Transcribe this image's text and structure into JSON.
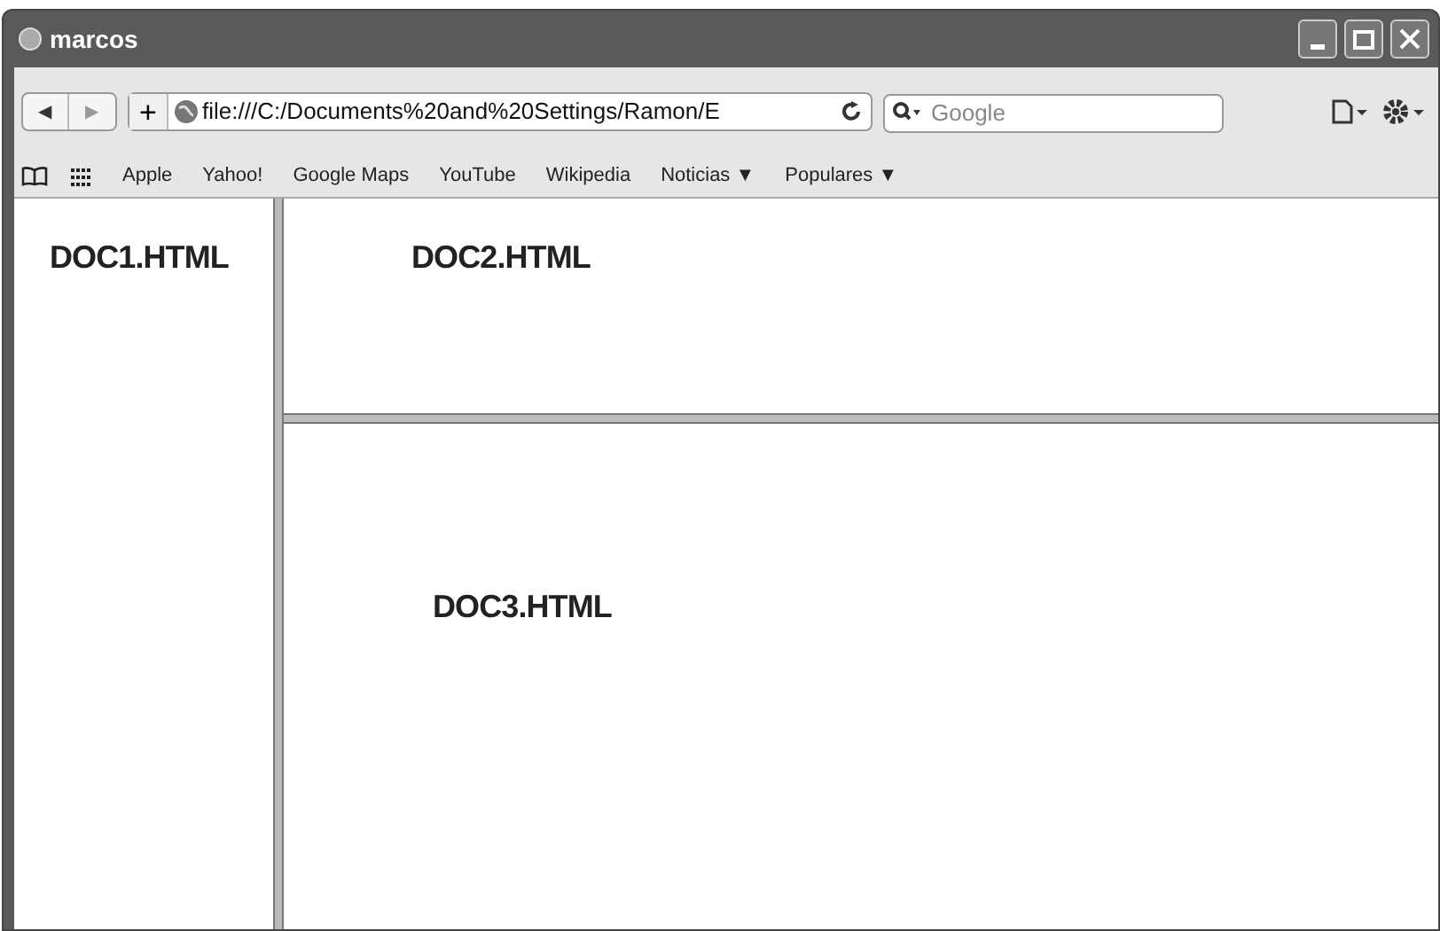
{
  "window": {
    "title": "marcos"
  },
  "toolbar": {
    "back": "◀",
    "forward": "▶",
    "add": "+",
    "address": "file:///C:/Documents%20and%20Settings/Ramon/E",
    "search": {
      "placeholder": "Google"
    }
  },
  "bookmarks": [
    {
      "label": "Apple"
    },
    {
      "label": "Yahoo!"
    },
    {
      "label": "Google Maps"
    },
    {
      "label": "YouTube"
    },
    {
      "label": "Wikipedia"
    },
    {
      "label": "Noticias",
      "arrow": "▼"
    },
    {
      "label": "Populares",
      "arrow": "▼"
    }
  ],
  "frames": [
    {
      "text": "DOC1.HTML"
    },
    {
      "text": "DOC2.HTML"
    },
    {
      "text": "DOC3.HTML"
    }
  ]
}
